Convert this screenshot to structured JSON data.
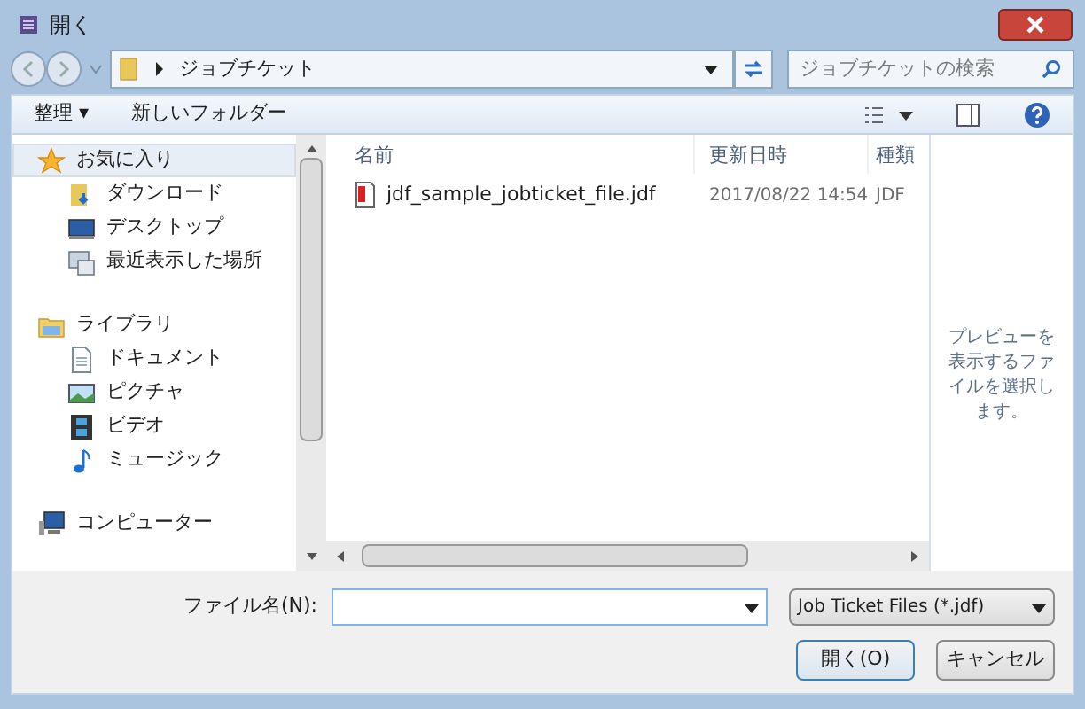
{
  "window": {
    "title": "開く"
  },
  "address": {
    "path": "ジョブチケット",
    "search_placeholder": "ジョブチケットの検索"
  },
  "toolbar": {
    "organize": "整理 ▾",
    "new_folder": "新しいフォルダー"
  },
  "sidebar": {
    "groups": [
      {
        "label": "お気に入り",
        "kind": "star",
        "selected": true,
        "children": [
          {
            "label": "ダウンロード",
            "kind": "download",
            "selected": false
          },
          {
            "label": "デスクトップ",
            "kind": "desktop",
            "selected": false
          },
          {
            "label": "最近表示した場所",
            "kind": "recent",
            "selected": false
          }
        ]
      },
      {
        "label": "ライブラリ",
        "kind": "library",
        "selected": false,
        "children": [
          {
            "label": "ドキュメント",
            "kind": "document",
            "selected": false
          },
          {
            "label": "ピクチャ",
            "kind": "picture",
            "selected": false
          },
          {
            "label": "ビデオ",
            "kind": "video",
            "selected": false
          },
          {
            "label": "ミュージック",
            "kind": "music",
            "selected": false
          }
        ]
      },
      {
        "label": "コンピューター",
        "kind": "computer",
        "selected": false
      }
    ]
  },
  "table": {
    "columns": [
      "名前",
      "更新日時",
      "種類"
    ],
    "rows": [
      {
        "name": "jdf_sample_jobticket_file.jdf",
        "modified": "2017/08/22 14:54",
        "type": "JDF",
        "selected": false
      }
    ]
  },
  "preview": {
    "message": "プレビューを表示するファイルを選択します。"
  },
  "footer": {
    "filename_label": "ファイル名(N):",
    "filter": "Job Ticket Files (*.jdf)",
    "open": "開く(O)",
    "cancel": "キャンセル"
  }
}
